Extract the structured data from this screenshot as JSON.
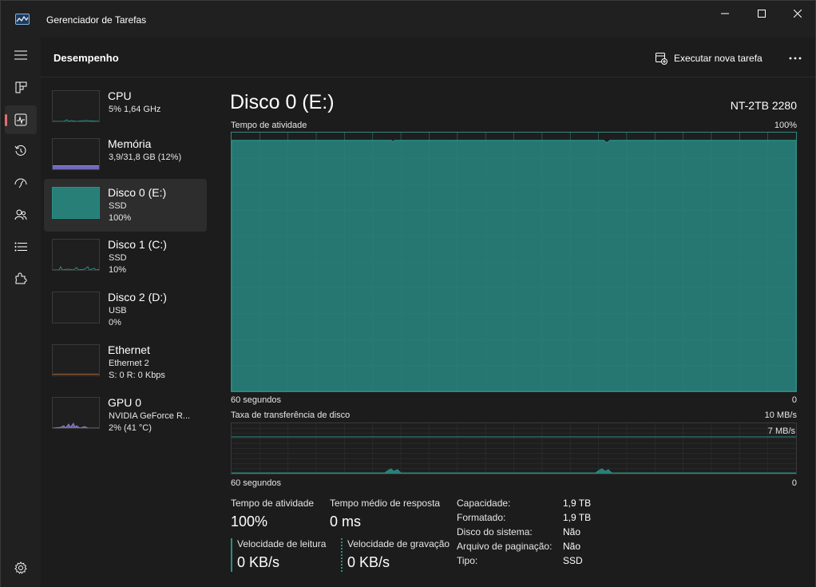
{
  "window": {
    "title": "Gerenciador de Tarefas"
  },
  "header": {
    "title": "Desempenho",
    "run_task_label": "Executar nova tarefa"
  },
  "colors": {
    "disk_accent": "#2a8f86",
    "disk_fill": "#277f78",
    "memory_accent": "#8f86d8",
    "gpu_accent": "#9a8ad0",
    "rail_active": "#e36f6f"
  },
  "rail": {
    "items": [
      "menu-icon",
      "processes-icon",
      "performance-icon",
      "app-history-icon",
      "startup-icon",
      "users-icon",
      "details-icon",
      "services-icon",
      "settings-icon"
    ]
  },
  "devices": [
    {
      "name": "CPU",
      "line1": "5% 1,64 GHz",
      "line2": ""
    },
    {
      "name": "Memória",
      "line1": "3,9/31,8 GB (12%)",
      "line2": ""
    },
    {
      "name": "Disco 0 (E:)",
      "line1": "SSD",
      "line2": "100%"
    },
    {
      "name": "Disco 1 (C:)",
      "line1": "SSD",
      "line2": "10%"
    },
    {
      "name": "Disco 2 (D:)",
      "line1": "USB",
      "line2": "0%"
    },
    {
      "name": "Ethernet",
      "line1": "Ethernet 2",
      "line2": "S: 0 R: 0 Kbps"
    },
    {
      "name": "GPU 0",
      "line1": "NVIDIA GeForce R...",
      "line2": "2% (41 °C)"
    }
  ],
  "main": {
    "title": "Disco 0 (E:)",
    "model": "NT-2TB 2280",
    "graph1": {
      "label": "Tempo de atividade",
      "max": "100%",
      "xleft": "60 segundos",
      "xright": "0",
      "level": 0.97
    },
    "graph2": {
      "label": "Taxa de transferência de disco",
      "max": "10 MB/s",
      "mid": "7 MB/s",
      "xleft": "60 segundos",
      "xright": "0"
    },
    "stats": {
      "active_label": "Tempo de atividade",
      "active_value": "100%",
      "response_label": "Tempo médio de resposta",
      "response_value": "0 ms",
      "read_label": "Velocidade de leitura",
      "read_value": "0 KB/s",
      "write_label": "Velocidade de gravação",
      "write_value": "0 KB/s"
    },
    "properties": [
      {
        "key": "Capacidade:",
        "value": "1,9 TB"
      },
      {
        "key": "Formatado:",
        "value": "1,9 TB"
      },
      {
        "key": "Disco do sistema:",
        "value": "Não"
      },
      {
        "key": "Arquivo de paginação:",
        "value": "Não"
      },
      {
        "key": "Tipo:",
        "value": "SSD"
      }
    ]
  }
}
